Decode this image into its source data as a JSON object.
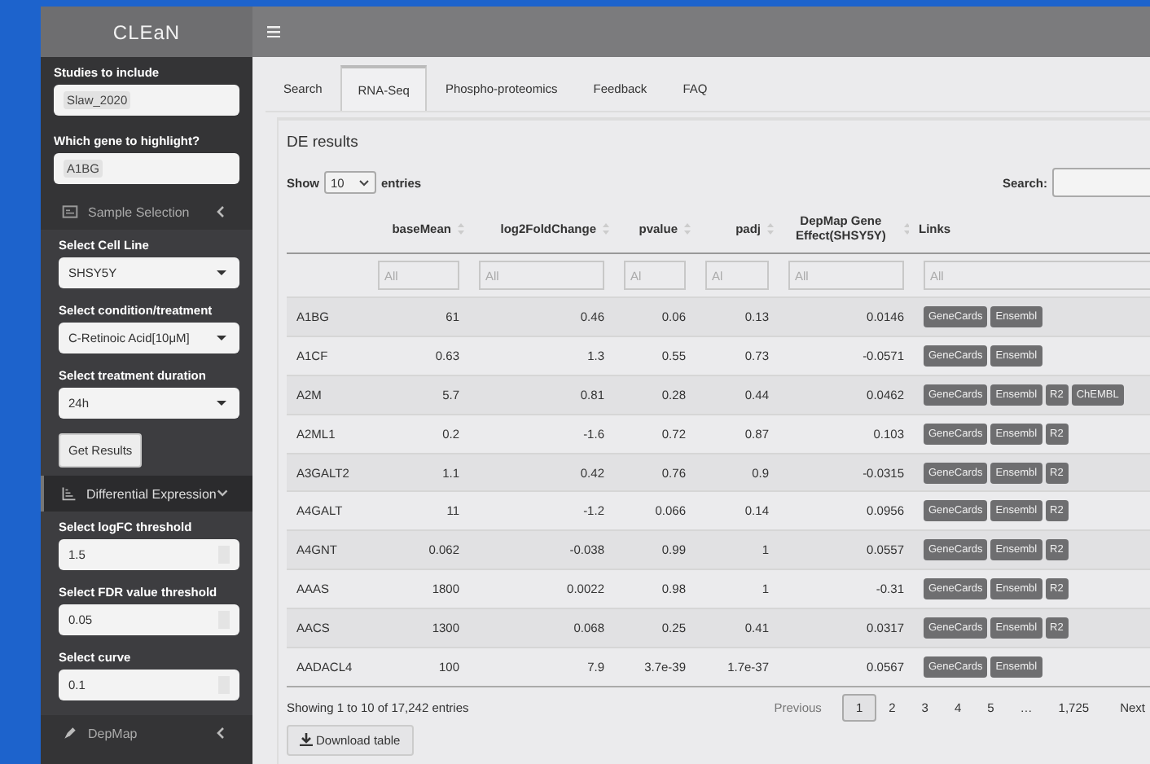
{
  "header": {
    "title": "CLEaN"
  },
  "sidebar": {
    "items": [
      {
        "kind": "tag-input",
        "label": "Studies to include",
        "value": "Slaw_2020"
      },
      {
        "kind": "tag-input",
        "label": "Which gene to highlight?",
        "value": "A1BG"
      },
      {
        "kind": "menu",
        "label": "Sample Selection",
        "expanded": false,
        "selected": false
      },
      {
        "kind": "select",
        "label": "Select Cell Line",
        "value": "SHSY5Y"
      },
      {
        "kind": "select",
        "label": "Select condition/treatment",
        "value": "C-Retinoic Acid[10μM]"
      },
      {
        "kind": "select",
        "label": "Select treatment duration",
        "value": "24h"
      },
      {
        "kind": "button",
        "label": "Get Results"
      },
      {
        "kind": "menu",
        "label": "Differential Expression",
        "expanded": true,
        "selected": true
      },
      {
        "kind": "number",
        "label": "Select logFC threshold",
        "value": "1.5"
      },
      {
        "kind": "number",
        "label": "Select FDR value threshold",
        "value": "0.05"
      },
      {
        "kind": "number",
        "label": "Select curve",
        "value": "0.1"
      },
      {
        "kind": "menu",
        "label": "DepMap",
        "expanded": false,
        "selected": false
      }
    ]
  },
  "tabs": [
    {
      "label": "Search",
      "selected": false
    },
    {
      "label": "RNA-Seq",
      "selected": true
    },
    {
      "label": "Phospho-proteomics",
      "selected": false
    },
    {
      "label": "Feedback",
      "selected": false
    },
    {
      "label": "FAQ",
      "selected": false
    }
  ],
  "panel": {
    "title": "DE results",
    "length": {
      "before": "Show",
      "value": "10",
      "after": "entries"
    },
    "search": {
      "label": "Search:"
    },
    "table": {
      "columns": [
        "baseMean",
        "log2FoldChange",
        "pvalue",
        "padj",
        "DepMap Gene Effect(SHSY5Y)",
        "Links"
      ],
      "filters": [
        "All",
        "All",
        "Al",
        "Al",
        "All",
        "All"
      ],
      "rows": [
        {
          "gene": "A1BG",
          "cells": [
            "61",
            "0.46",
            "0.06",
            "0.13",
            "0.0146"
          ],
          "links": [
            "GeneCards",
            "Ensembl"
          ]
        },
        {
          "gene": "A1CF",
          "cells": [
            "0.63",
            "1.3",
            "0.55",
            "0.73",
            "-0.0571"
          ],
          "links": [
            "GeneCards",
            "Ensembl"
          ]
        },
        {
          "gene": "A2M",
          "cells": [
            "5.7",
            "0.81",
            "0.28",
            "0.44",
            "0.0462"
          ],
          "links": [
            "GeneCards",
            "Ensembl",
            "R2",
            "ChEMBL"
          ]
        },
        {
          "gene": "A2ML1",
          "cells": [
            "0.2",
            "-1.6",
            "0.72",
            "0.87",
            "0.103"
          ],
          "links": [
            "GeneCards",
            "Ensembl",
            "R2"
          ]
        },
        {
          "gene": "A3GALT2",
          "cells": [
            "1.1",
            "0.42",
            "0.76",
            "0.9",
            "-0.0315"
          ],
          "links": [
            "GeneCards",
            "Ensembl",
            "R2"
          ]
        },
        {
          "gene": "A4GALT",
          "cells": [
            "11",
            "-1.2",
            "0.066",
            "0.14",
            "0.0956"
          ],
          "links": [
            "GeneCards",
            "Ensembl",
            "R2"
          ]
        },
        {
          "gene": "A4GNT",
          "cells": [
            "0.062",
            "-0.038",
            "0.99",
            "1",
            "0.0557"
          ],
          "links": [
            "GeneCards",
            "Ensembl",
            "R2"
          ]
        },
        {
          "gene": "AAAS",
          "cells": [
            "1800",
            "0.0022",
            "0.98",
            "1",
            "-0.31"
          ],
          "links": [
            "GeneCards",
            "Ensembl",
            "R2"
          ]
        },
        {
          "gene": "AACS",
          "cells": [
            "1300",
            "0.068",
            "0.25",
            "0.41",
            "0.0317"
          ],
          "links": [
            "GeneCards",
            "Ensembl",
            "R2"
          ]
        },
        {
          "gene": "AADACL4",
          "cells": [
            "100",
            "7.9",
            "3.7e-39",
            "1.7e-37",
            "0.0567"
          ],
          "links": [
            "GeneCards",
            "Ensembl"
          ]
        }
      ]
    },
    "info": "Showing 1 to 10 of 17,242 entries",
    "pagination": {
      "previous": "Previous",
      "pages": [
        {
          "label": "1",
          "selected": true
        },
        {
          "label": "2",
          "selected": false
        },
        {
          "label": "3",
          "selected": false
        },
        {
          "label": "4",
          "selected": false
        },
        {
          "label": "5",
          "selected": false
        },
        {
          "label": "…",
          "selected": false
        },
        {
          "label": "1,725",
          "selected": false
        }
      ],
      "next": "Next"
    },
    "download": "Download table"
  }
}
